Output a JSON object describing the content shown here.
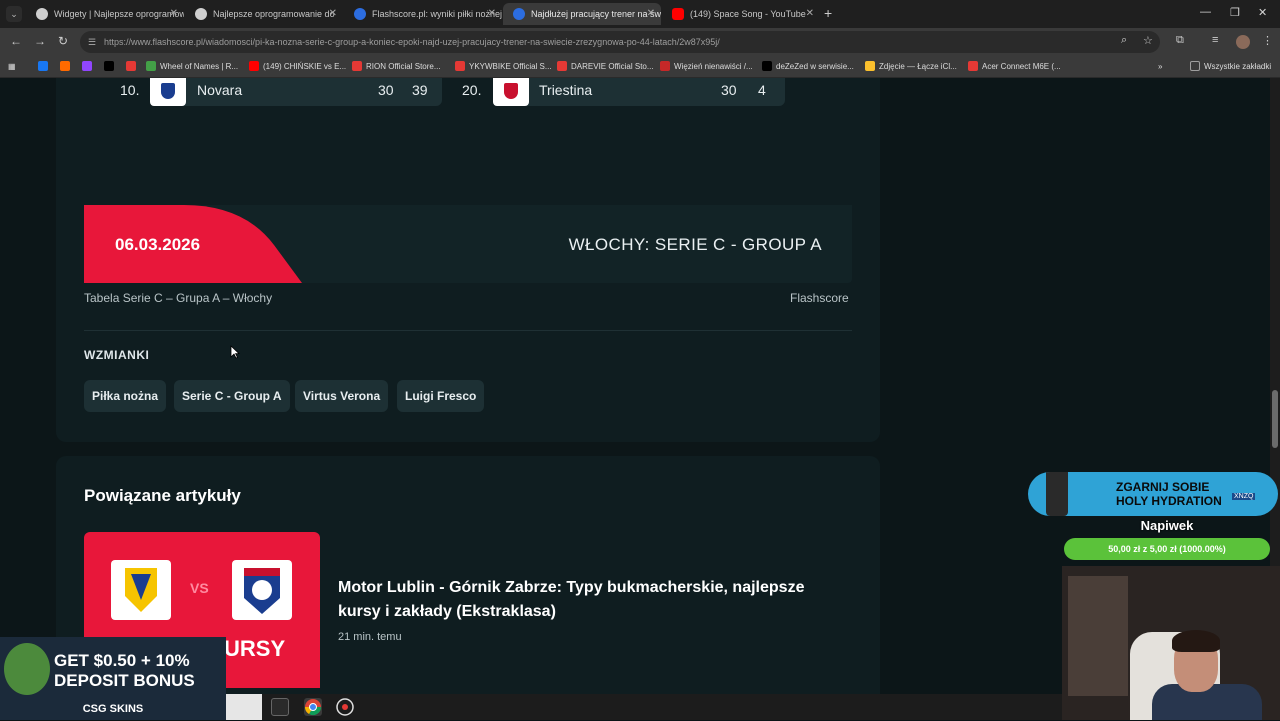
{
  "tabs": [
    {
      "title": "Widgety | Najlepsze oprogramowanie",
      "active": false,
      "favicon_color": "#cfcfcf"
    },
    {
      "title": "Najlepsze oprogramowanie do",
      "active": false,
      "favicon_color": "#cfcfcf"
    },
    {
      "title": "Flashscore.pl: wyniki piłki nożnej",
      "active": false,
      "favicon_color": "#2c6de0"
    },
    {
      "title": "Najdłużej pracujący trener na św",
      "active": true,
      "favicon_color": "#2c6de0"
    },
    {
      "title": "(149) Space Song - YouTube",
      "active": false,
      "favicon_color": "#ff0000"
    }
  ],
  "address": {
    "url": "https://www.flashscore.pl/wiadomosci/pi-ka-nozna-serie-c-group-a-koniec-epoki-najd-uzej-pracujacy-trener-na-swiecie-zrezygnowa-po-44-latach/2w87x95j/"
  },
  "bookmarks": [
    {
      "label": "",
      "color": "#1877f2"
    },
    {
      "label": "",
      "color": "#ff6a00"
    },
    {
      "label": "",
      "color": "#9146ff"
    },
    {
      "label": "",
      "color": "#000000"
    },
    {
      "label": "",
      "color": "#e53935"
    },
    {
      "label": "Wheel of Names | R...",
      "color": "#43a047"
    },
    {
      "label": "(149) CHIŃSKIE vs E...",
      "color": "#ff0000"
    },
    {
      "label": "RION Official Store...",
      "color": "#e53935"
    },
    {
      "label": "YKYWBIKE Official S...",
      "color": "#e53935"
    },
    {
      "label": "DAREVIE Official Sto...",
      "color": "#e53935"
    },
    {
      "label": "Więzień nienawiści /...",
      "color": "#c62828"
    },
    {
      "label": "deZeZed w serwisie...",
      "color": "#000000"
    },
    {
      "label": "Zdjęcie — Łącze iCl...",
      "color": "#fbc02d"
    },
    {
      "label": "Acer Connect M6E (...",
      "color": "#e53935"
    },
    {
      "label": "Wszystkie zakładki",
      "color": "#9e9e9e"
    }
  ],
  "standings": [
    {
      "pos": "10.",
      "team": "Novara",
      "played": "30",
      "points": "39",
      "crest_color": "#1a3d8f"
    },
    {
      "pos": "20.",
      "team": "Triestina",
      "played": "30",
      "points": "4",
      "crest_color": "#c8102e"
    }
  ],
  "banner": {
    "date": "06.03.2026",
    "league": "WŁOCHY: SERIE C - GROUP A",
    "accent": "#e8173a"
  },
  "caption": "Tabela Serie C – Grupa A – Włochy",
  "credit": "Flashscore",
  "mentions": {
    "heading": "WZMIANKI",
    "tags": [
      "Piłka nożna",
      "Serie C - Group A",
      "Virtus Verona",
      "Luigi Fresco"
    ]
  },
  "related": {
    "heading": "Powiązane artykuły",
    "articles": [
      {
        "title": "Motor Lublin - Górnik Zabrze: Typy bukmacherskie, najlepsze kursy i zakłady (Ekstraklasa)",
        "time": "21 min. temu",
        "thumb_vs": "VS",
        "thumb_label": "URSY"
      }
    ]
  },
  "overlays": {
    "ad_line1": "GET $0.50 + 10%",
    "ad_line2": "DEPOSIT BONUS",
    "ad_brand": "CSG SKINS",
    "tip_banner_line1": "ZGARNIJ SOBIE",
    "tip_banner_line2": "HOLY HYDRATION",
    "tip_banner_code": "XNZQ",
    "tip_label": "Napiwek",
    "tip_progress_text": "50,00 zł z 5,00 zł (1000.00%)"
  }
}
